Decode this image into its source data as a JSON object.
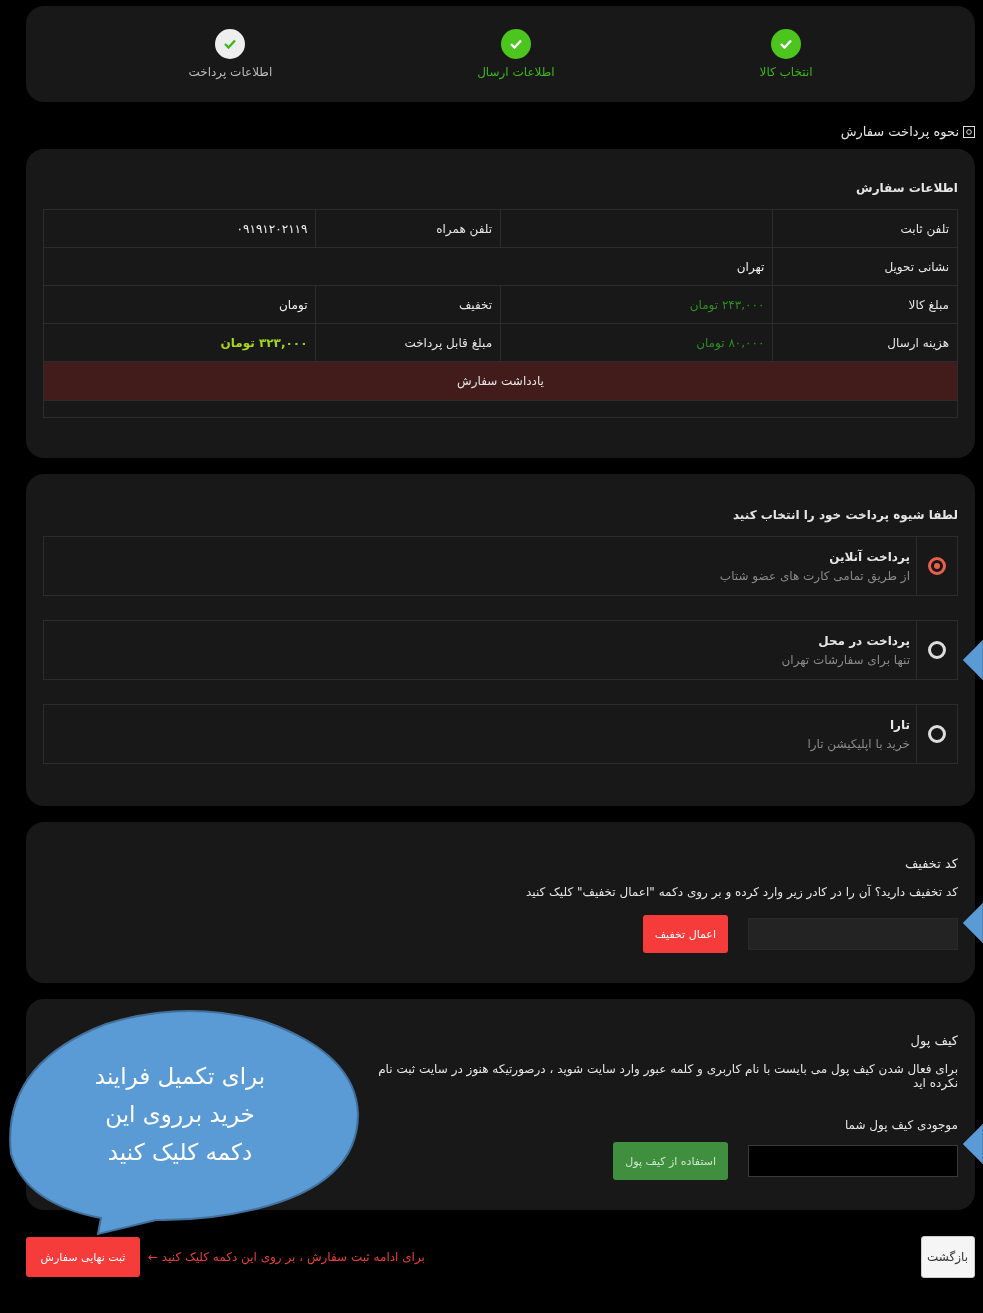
{
  "steps": [
    {
      "label": "انتخاب کالا",
      "current": false
    },
    {
      "label": "اطلاعات ارسال",
      "current": false
    },
    {
      "label": "اطلاعات پرداخت",
      "current": true
    }
  ],
  "section_title": "نحوه پرداخت سفارش",
  "order_info": {
    "title": "اطلاعات سفارش",
    "rows": [
      {
        "cells": [
          {
            "label": "تلفن ثابت"
          },
          {
            "label": "تلفن همراه",
            "value": "۰۹۱۹۱۲۰۲۱۱۹",
            "kind": "plain"
          }
        ]
      },
      {
        "cells": [
          {
            "label": "نشانی تحویل",
            "value": "تهران",
            "kind": "plain"
          }
        ]
      },
      {
        "cells": [
          {
            "label": "مبلغ کالا",
            "value": "۲۴۳,۰۰۰ تومان",
            "kind": "price"
          },
          {
            "label": "تخفیف",
            "value": "تومان",
            "kind": "plain"
          }
        ]
      },
      {
        "cells": [
          {
            "label": "هزینه ارسال",
            "value": "۸۰,۰۰۰ تومان",
            "kind": "price"
          },
          {
            "label": "مبلغ قابل پرداخت",
            "value": "۳۲۳,۰۰۰ تومان",
            "kind": "total"
          }
        ]
      }
    ],
    "note_title": "یادداشت سفارش"
  },
  "payment": {
    "prompt": "لطفا شیوه پرداخت خود را انتخاب کنید",
    "methods": [
      {
        "title": "پرداخت آنلاین",
        "subtitle": "از طریق تمامی کارت های عضو شتاب",
        "selected": true
      },
      {
        "title": "پرداخت در محل",
        "subtitle": "تنها برای سفارشات تهران",
        "selected": false
      },
      {
        "title": "تارا",
        "subtitle": "خرید با اپلیکیشن تارا",
        "selected": false
      }
    ]
  },
  "discount": {
    "title": "کد تخفیف",
    "description": "کد تخفیف دارید؟ آن را در کادر زیر وارد کرده و بر روی دکمه \"اعمال تخفیف\" کلیک کنید",
    "button": "اعمال تخفیف"
  },
  "wallet": {
    "title": "کیف پول",
    "description": "برای فعال شدن کیف پول می بایست با نام کاربری و کلمه عبور وارد سایت شوید ، درصورتیکه هنوز در سایت ثبت نام نکرده اید",
    "balance_label": "موجودی کیف پول شما",
    "button": "استفاده از کیف پول"
  },
  "footer": {
    "back_button": "بازگشت",
    "hint": "برای ادامه ثبت سفارش ، بر روی این دکمه کلیک کنید ←",
    "submit_button": "ثبت نهایی سفارش"
  },
  "callout": {
    "text": "برای تکمیل فرایند خرید برروی این دکمه کلیک کنید"
  }
}
